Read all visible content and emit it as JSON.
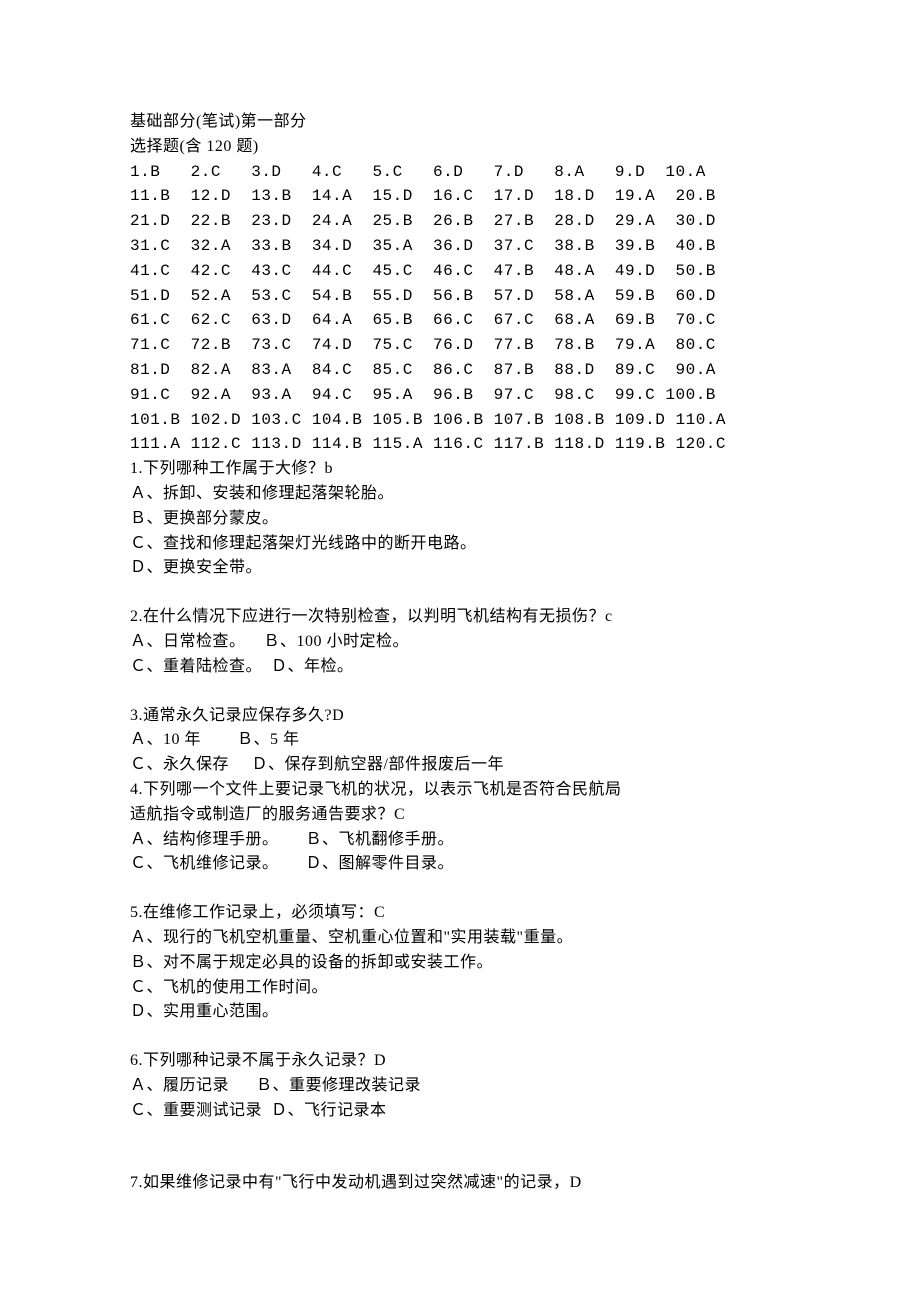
{
  "heading1": "基础部分(笔试)第一部分",
  "heading2": "选择题(含 120 题)",
  "answerRows": [
    "1.B   2.C   3.D   4.C   5.C   6.D   7.D   8.A   9.D  10.A",
    "11.B  12.D  13.B  14.A  15.D  16.C  17.D  18.D  19.A  20.B",
    "21.D  22.B  23.D  24.A  25.B  26.B  27.B  28.D  29.A  30.D",
    "31.C  32.A  33.B  34.D  35.A  36.D  37.C  38.B  39.B  40.B",
    "41.C  42.C  43.C  44.C  45.C  46.C  47.B  48.A  49.D  50.B",
    "51.D  52.A  53.C  54.B  55.D  56.B  57.D  58.A  59.B  60.D",
    "61.C  62.C  63.D  64.A  65.B  66.C  67.C  68.A  69.B  70.C",
    "71.C  72.B  73.C  74.D  75.C  76.D  77.B  78.B  79.A  80.C",
    "81.D  82.A  83.A  84.C  85.C  86.C  87.B  88.D  89.C  90.A",
    "91.C  92.A  93.A  94.C  95.A  96.B  97.C  98.C  99.C 100.B",
    "101.B 102.D 103.C 104.B 105.B 106.B 107.B 108.B 109.D 110.A",
    "111.A 112.C 113.D 114.B 115.A 116.C 117.B 118.D 119.B 120.C"
  ],
  "q1": {
    "stem": "1.下列哪种工作属于大修？b",
    "a": "Ａ、拆卸、安装和修理起落架轮胎。",
    "b": "Ｂ、更换部分蒙皮。",
    "c": "Ｃ、查找和修理起落架灯光线路中的断开电路。",
    "d": "Ｄ、更换安全带。"
  },
  "q2": {
    "stem": "2.在什么情况下应进行一次特别检查，以判明飞机结构有无损伤？c",
    "row1": "Ａ、日常检查。    Ｂ、100 小时定检。",
    "row2": "Ｃ、重着陆检查。  Ｄ、年检。"
  },
  "q3": {
    "stem": "3.通常永久记录应保存多久?D",
    "row1": "Ａ、10 年        Ｂ、5 年",
    "row2": "Ｃ、永久保存     Ｄ、保存到航空器/部件报废后一年"
  },
  "q4": {
    "stem1": "4.下列哪一个文件上要记录飞机的状况，以表示飞机是否符合民航局",
    "stem2": "适航指令或制造厂的服务通告要求？C",
    "row1": "Ａ、结构修理手册。      Ｂ、飞机翻修手册。",
    "row2": "Ｃ、飞机维修记录。      Ｄ、图解零件目录。"
  },
  "q5": {
    "stem": "5.在维修工作记录上，必须填写：C",
    "a": "Ａ、现行的飞机空机重量、空机重心位置和\"实用装载\"重量。",
    "b": "Ｂ、对不属于规定必具的设备的拆卸或安装工作。",
    "c": "Ｃ、飞机的使用工作时间。",
    "d": "Ｄ、实用重心范围。"
  },
  "q6": {
    "stem": "6.下列哪种记录不属于永久记录？D",
    "row1": "Ａ、履历记录      Ｂ、重要修理改装记录",
    "row2": "Ｃ、重要测试记录  Ｄ、飞行记录本"
  },
  "q7": {
    "stem": "7.如果维修记录中有\"飞行中发动机遇到过突然减速\"的记录，D"
  }
}
